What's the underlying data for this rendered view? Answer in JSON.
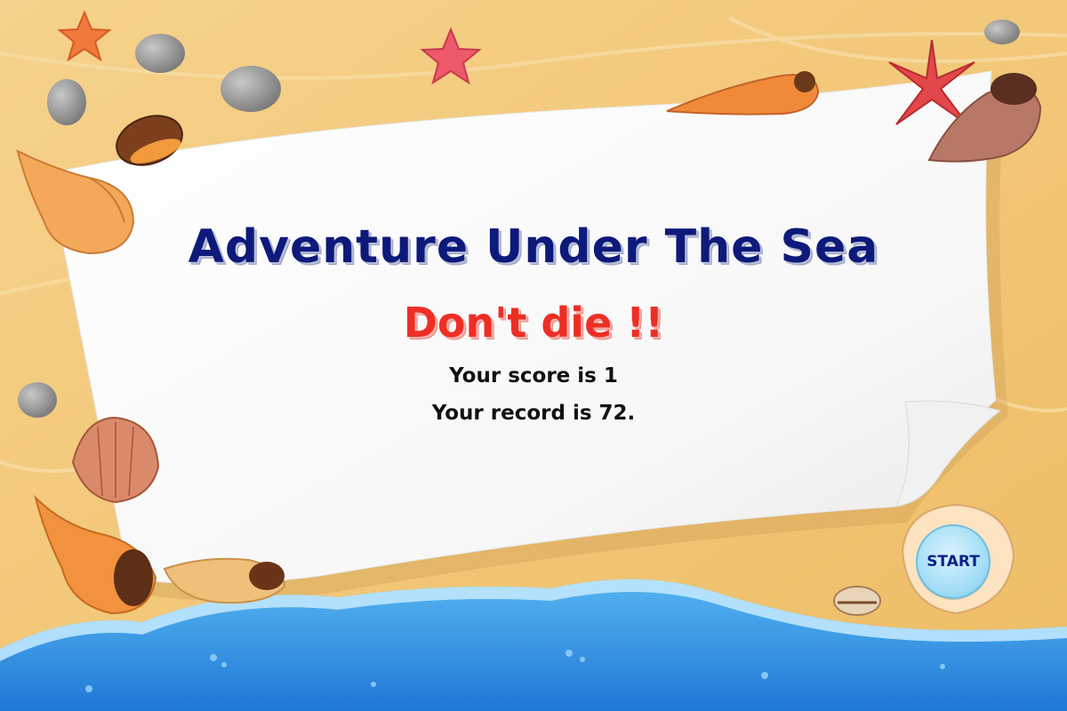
{
  "game": {
    "title": "Adventure Under The Sea",
    "subtitle": "Don't die !!",
    "score_text": "Your score is 1",
    "record_text": "Your record is 72.",
    "start_label": "START"
  },
  "colors": {
    "sand": "#f2c879",
    "paper": "#ffffff",
    "title": "#0d1a7a",
    "subtitle": "#ee2e24",
    "water": "#2f8ee0",
    "start_button": "#a9e0f7"
  },
  "decorations": [
    "starfish-icon",
    "pebble-icon",
    "seashell-icon",
    "conch-icon",
    "scallop-icon",
    "cowrie-icon",
    "wave-icon"
  ]
}
